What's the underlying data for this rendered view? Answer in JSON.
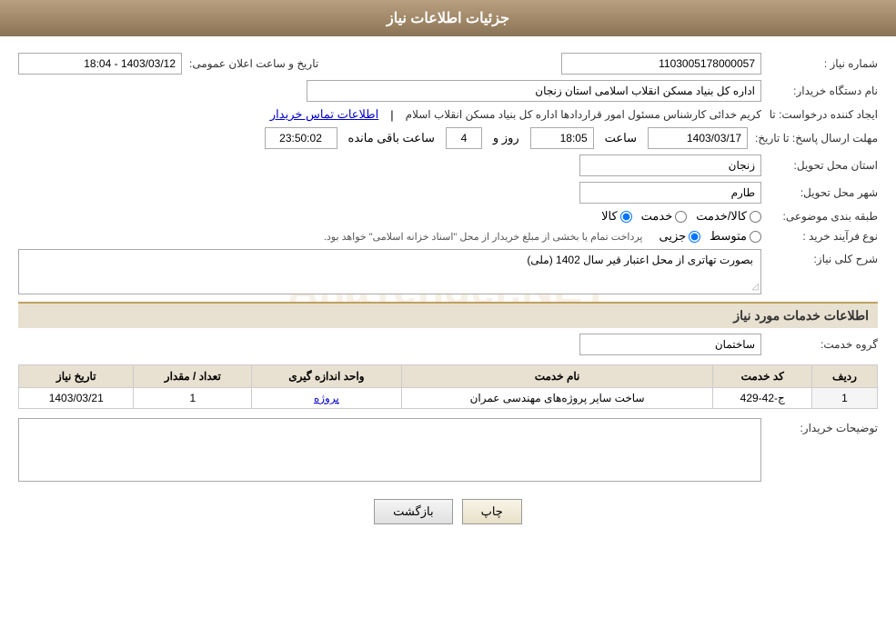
{
  "header": {
    "title": "جزئیات اطلاعات نیاز"
  },
  "fields": {
    "need_number_label": "شماره نیاز :",
    "need_number_value": "1103005178000057",
    "announcement_date_label": "تاریخ و ساعت اعلان عمومی:",
    "announcement_date_value": "1403/03/12 - 18:04",
    "buyer_org_label": "نام دستگاه خریدار:",
    "buyer_org_value": "اداره کل بنیاد مسکن انقلاب اسلامی استان زنجان",
    "creator_label": "ایجاد کننده درخواست: تا",
    "creator_value": "کریم خدائی کارشناس مسئول امور قراردادها اداره کل بنیاد مسکن انقلاب اسلام",
    "creator_link": "اطلاعات تماس خریدار",
    "reply_date_label": "مهلت ارسال پاسخ: تا تاریخ:",
    "reply_date_value": "1403/03/17",
    "reply_time_label": "ساعت",
    "reply_time_value": "18:05",
    "reply_days_label": "روز و",
    "reply_days_value": "4",
    "reply_remaining_label": "ساعت باقی مانده",
    "reply_remaining_value": "23:50:02",
    "province_label": "استان محل تحویل:",
    "province_value": "زنجان",
    "city_label": "شهر محل تحویل:",
    "city_value": "طارم",
    "category_label": "طبقه بندی موضوعی:",
    "category_options": [
      "کالا",
      "خدمت",
      "کالا/خدمت"
    ],
    "category_selected": "کالا",
    "process_label": "نوع فرآیند خرید :",
    "process_options": [
      "جزیی",
      "متوسط"
    ],
    "process_note": "پرداخت تمام یا بخشی از مبلغ خریدار از محل \"اسناد خزانه اسلامی\" خواهد بود.",
    "description_label": "شرح کلی نیاز:",
    "description_value": "بصورت تهاتری از محل اعتبار قیر سال 1402 (ملی)",
    "services_header": "اطلاعات خدمات مورد نیاز",
    "service_group_label": "گروه خدمت:",
    "service_group_value": "ساختمان",
    "table_headers": {
      "row_num": "ردیف",
      "service_code": "کد خدمت",
      "service_name": "نام خدمت",
      "unit": "واحد اندازه گیری",
      "count": "تعداد / مقدار",
      "date": "تاریخ نیاز"
    },
    "table_rows": [
      {
        "row_num": "1",
        "service_code": "ج-42-429",
        "service_name": "ساخت سایر پروژه‌های مهندسی عمران",
        "unit": "پروژه",
        "count": "1",
        "date": "1403/03/21"
      }
    ],
    "buyer_notes_label": "توضیحات خریدار:",
    "buyer_notes_value": "",
    "btn_back": "بازگشت",
    "btn_print": "چاپ"
  }
}
